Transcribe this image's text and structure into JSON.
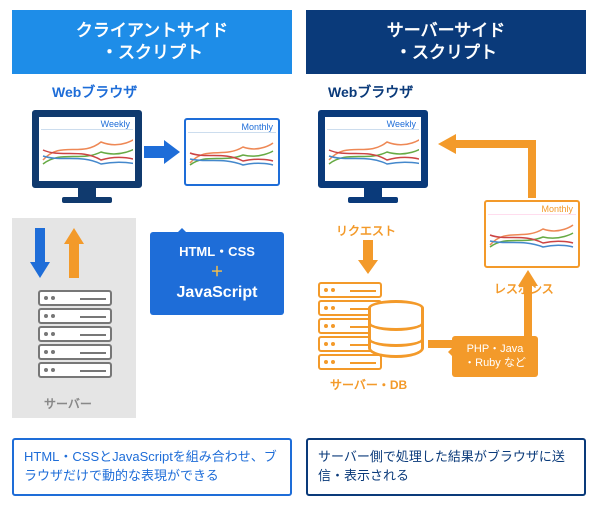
{
  "left": {
    "header": "クライアントサイド\n・スクリプト",
    "browser_label": "Webブラウザ",
    "tab1": "Weekly",
    "tab2": "Monthly",
    "server_label": "サーバー",
    "speech_line1": "HTML・CSS",
    "speech_plus": "＋",
    "speech_line2": "JavaScript",
    "caption": "HTML・CSSとJavaScriptを組み合わせ、ブラウザだけで動的な表現ができる"
  },
  "right": {
    "header": "サーバーサイド\n・スクリプト",
    "browser_label": "Webブラウザ",
    "tab1": "Weekly",
    "tab2": "Monthly",
    "request_label": "リクエスト",
    "response_label": "レスポンス",
    "server_label": "サーバー・DB",
    "speech": "PHP・Java\n・Ruby など",
    "caption": "サーバー側で処理した結果がブラウザに送信・表示される"
  }
}
